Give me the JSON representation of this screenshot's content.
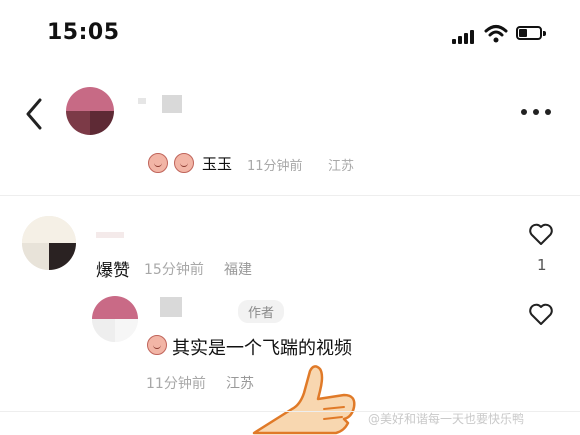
{
  "status_bar": {
    "time": "15:05"
  },
  "post": {
    "meta_user": "玉玉",
    "meta_time": "11分钟前",
    "meta_location": "江苏"
  },
  "comments": [
    {
      "text": "爆赞",
      "time": "15分钟前",
      "location": "福建",
      "like_count": "1"
    },
    {
      "author_badge": "作者",
      "text": "其实是一个飞踹的视频",
      "time": "11分钟前",
      "location": "江苏"
    }
  ],
  "watermark": "@美好和谐每一天也要快乐鸭",
  "icons": {
    "back": "chevron-left-icon",
    "more": "more-dots-icon",
    "like": "heart-outline-icon",
    "sticker": "peach-face-sticker-icon",
    "thumbs_up": "thumbs-up-hand-icon"
  }
}
